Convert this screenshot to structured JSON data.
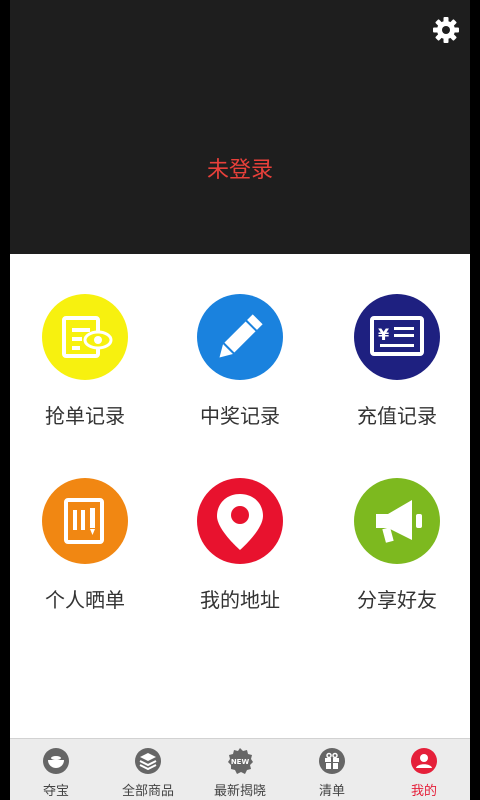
{
  "header": {
    "login_status": "未登录",
    "settings_icon": "gear-icon"
  },
  "grid": [
    {
      "label": "抢单记录",
      "icon": "order-record-icon",
      "color": "#f7f10f"
    },
    {
      "label": "中奖记录",
      "icon": "pencil-icon",
      "color": "#1a82de"
    },
    {
      "label": "充值记录",
      "icon": "yen-card-icon",
      "color": "#1e2080"
    },
    {
      "label": "个人晒单",
      "icon": "document-pen-icon",
      "color": "#f18712"
    },
    {
      "label": "我的地址",
      "icon": "location-pin-icon",
      "color": "#e8122e"
    },
    {
      "label": "分享好友",
      "icon": "megaphone-icon",
      "color": "#7db91f"
    }
  ],
  "tabbar": [
    {
      "label": "夺宝",
      "icon": "bowl-icon",
      "active": false
    },
    {
      "label": "全部商品",
      "icon": "layers-icon",
      "active": false
    },
    {
      "label": "最新揭晓",
      "icon": "new-badge-icon",
      "badge_text": "NEW",
      "active": false
    },
    {
      "label": "清单",
      "icon": "gift-icon",
      "active": false
    },
    {
      "label": "我的",
      "icon": "user-icon",
      "active": true
    }
  ],
  "colors": {
    "header_bg": "#1e1e1e",
    "accent": "#e5203a",
    "login_text": "#e8403a"
  }
}
